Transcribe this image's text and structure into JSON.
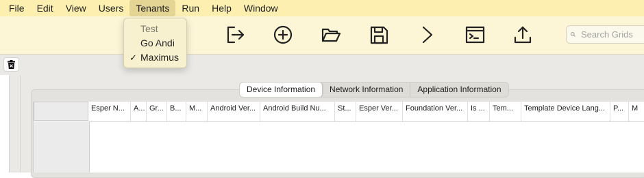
{
  "menubar": {
    "items": [
      "File",
      "Edit",
      "View",
      "Users",
      "Tenants",
      "Run",
      "Help",
      "Window"
    ],
    "active": "Tenants"
  },
  "tenants_menu": {
    "items": [
      {
        "label": "Test",
        "enabled": false,
        "checked": false
      },
      {
        "label": "Go Andi",
        "enabled": true,
        "checked": false
      },
      {
        "label": "Maximus",
        "enabled": true,
        "checked": true
      }
    ],
    "check_glyph": "✓"
  },
  "toolbar": {
    "icons": [
      "logout-icon",
      "add-circle-icon",
      "folder-open-icon",
      "save-icon",
      "chevron-right-icon",
      "terminal-icon",
      "upload-icon"
    ],
    "search_placeholder": "Search Grids"
  },
  "tabs": {
    "items": [
      "Device Information",
      "Network Information",
      "Application Information"
    ],
    "selected": "Device Information"
  },
  "grid": {
    "columns": [
      "Esper N...",
      "A...",
      "Gr...",
      "B...",
      "M...",
      "Android Ver...",
      "Android Build Nu...",
      "St...",
      "Esper Ver...",
      "Foundation Ver...",
      "Is ...",
      "Tem...",
      "Template Device Lang...",
      "P...",
      "M"
    ]
  },
  "colors": {
    "menubar": "#fcefb0",
    "toolbar": "#fcf5d6",
    "content_bg": "#eae9e5",
    "dropdown_bg": "#f8f1cf"
  }
}
